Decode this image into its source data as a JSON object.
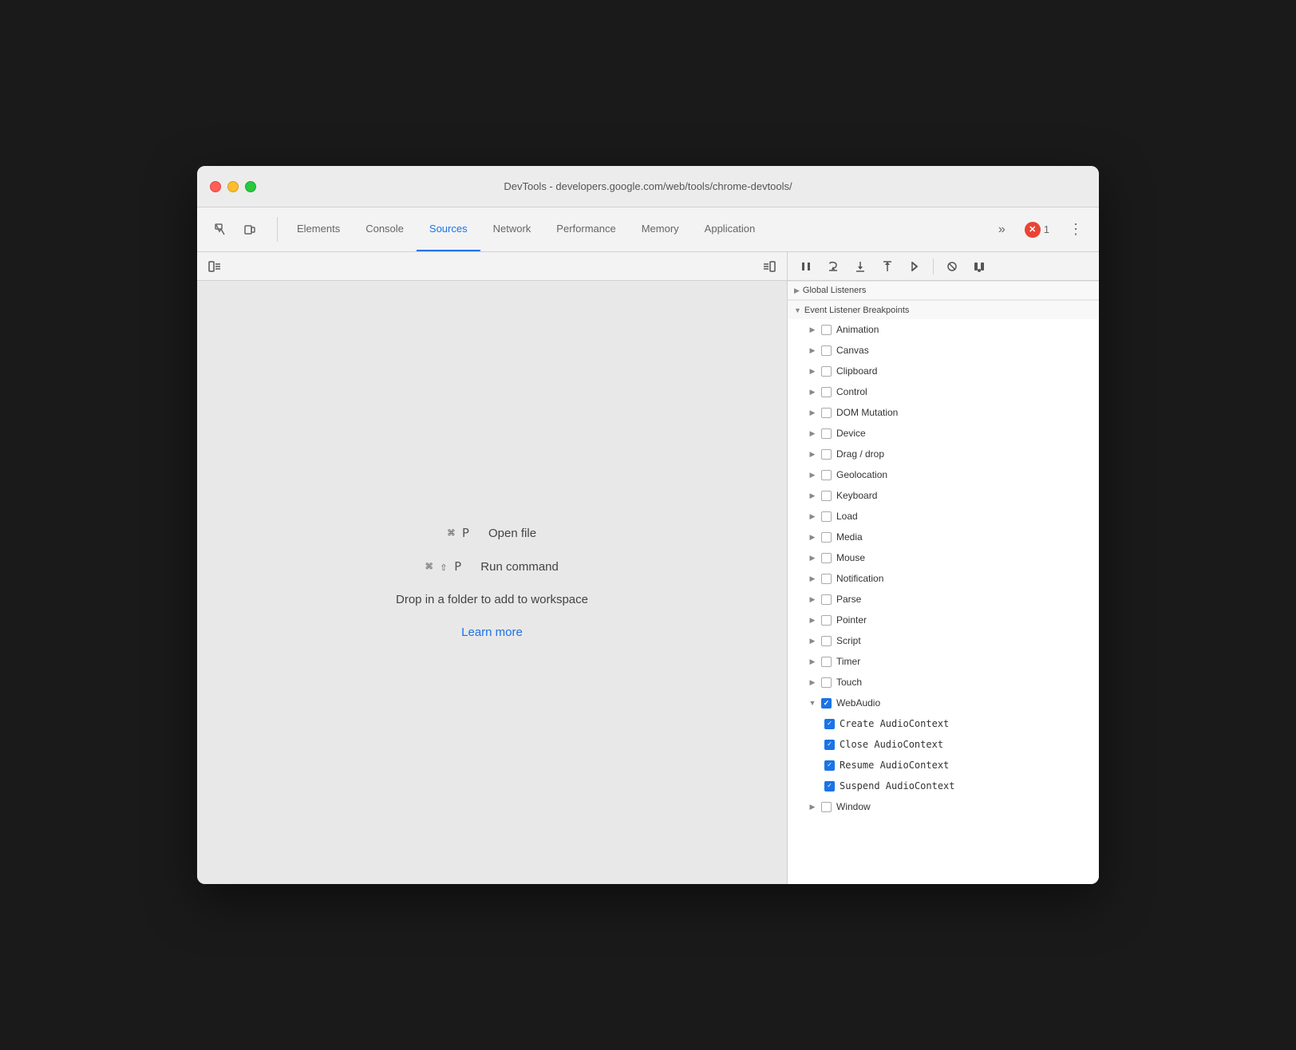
{
  "window": {
    "title": "DevTools - developers.google.com/web/tools/chrome-devtools/"
  },
  "tabs": {
    "items": [
      {
        "label": "Elements",
        "active": false
      },
      {
        "label": "Console",
        "active": false
      },
      {
        "label": "Sources",
        "active": true
      },
      {
        "label": "Network",
        "active": false
      },
      {
        "label": "Performance",
        "active": false
      },
      {
        "label": "Memory",
        "active": false
      },
      {
        "label": "Application",
        "active": false
      }
    ],
    "more_label": "»",
    "error_count": "1",
    "settings_icon": "⋮"
  },
  "sources_panel": {
    "open_file_shortcut": "⌘ P",
    "open_file_label": "Open file",
    "run_command_shortcut": "⌘ ⇧ P",
    "run_command_label": "Run command",
    "drop_text": "Drop in a folder to add to workspace",
    "learn_more": "Learn more"
  },
  "debugger": {
    "buttons": [
      "pause",
      "step_over",
      "step_into",
      "step_out",
      "step",
      "deactivate",
      "pause_on_exception"
    ]
  },
  "breakpoints": {
    "global_listeners_label": "Global Listeners",
    "event_listener_label": "Event Listener Breakpoints",
    "items": [
      {
        "label": "Animation",
        "checked": false,
        "expanded": false
      },
      {
        "label": "Canvas",
        "checked": false,
        "expanded": false
      },
      {
        "label": "Clipboard",
        "checked": false,
        "expanded": false
      },
      {
        "label": "Control",
        "checked": false,
        "expanded": false
      },
      {
        "label": "DOM Mutation",
        "checked": false,
        "expanded": false
      },
      {
        "label": "Device",
        "checked": false,
        "expanded": false
      },
      {
        "label": "Drag / drop",
        "checked": false,
        "expanded": false
      },
      {
        "label": "Geolocation",
        "checked": false,
        "expanded": false
      },
      {
        "label": "Keyboard",
        "checked": false,
        "expanded": false
      },
      {
        "label": "Load",
        "checked": false,
        "expanded": false
      },
      {
        "label": "Media",
        "checked": false,
        "expanded": false
      },
      {
        "label": "Mouse",
        "checked": false,
        "expanded": false
      },
      {
        "label": "Notification",
        "checked": false,
        "expanded": false
      },
      {
        "label": "Parse",
        "checked": false,
        "expanded": false
      },
      {
        "label": "Pointer",
        "checked": false,
        "expanded": false
      },
      {
        "label": "Script",
        "checked": false,
        "expanded": false
      },
      {
        "label": "Timer",
        "checked": false,
        "expanded": false
      },
      {
        "label": "Touch",
        "checked": false,
        "expanded": false
      },
      {
        "label": "WebAudio",
        "checked": true,
        "expanded": true
      },
      {
        "label": "Window",
        "checked": false,
        "expanded": false
      }
    ],
    "web_audio_subitems": [
      {
        "label": "Create AudioContext",
        "checked": true
      },
      {
        "label": "Close AudioContext",
        "checked": true
      },
      {
        "label": "Resume AudioContext",
        "checked": true
      },
      {
        "label": "Suspend AudioContext",
        "checked": true
      }
    ]
  }
}
